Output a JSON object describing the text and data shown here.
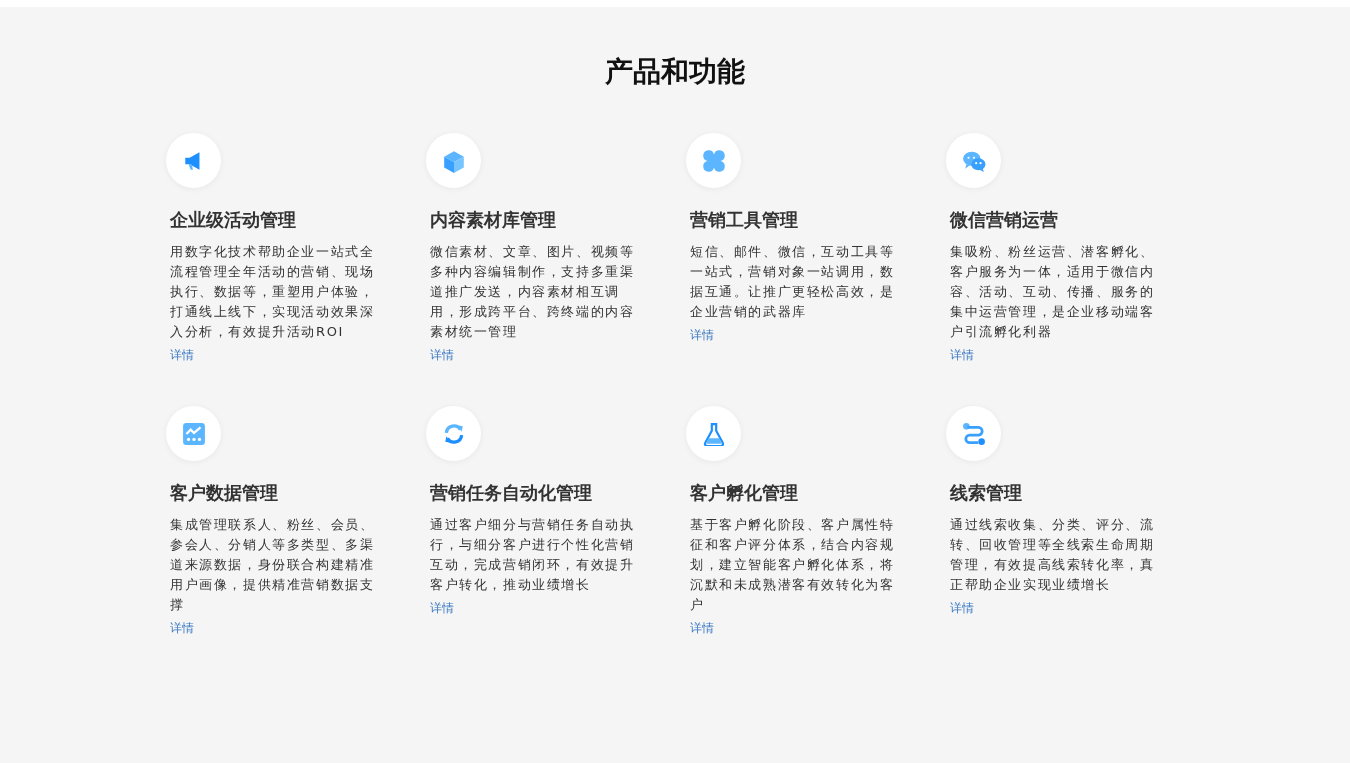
{
  "section": {
    "title": "产品和功能"
  },
  "features": [
    {
      "title": "企业级活动管理",
      "description": "用数字化技术帮助企业一站式全流程管理全年活动的营销、现场执行、数据等，重塑用户体验，打通线上线下，实现活动效果深入分析，有效提升活动ROI",
      "link": "详情"
    },
    {
      "title": "内容素材库管理",
      "description": "微信素材、文章、图片、视频等多种内容编辑制作，支持多重渠道推广发送，内容素材相互调用，形成跨平台、跨终端的内容素材统一管理",
      "link": "详情"
    },
    {
      "title": "营销工具管理",
      "description": "短信、邮件、微信，互动工具等一站式，营销对象一站调用，数据互通。让推广更轻松高效，是企业营销的武器库",
      "link": "详情"
    },
    {
      "title": "微信营销运营",
      "description": "集吸粉、粉丝运营、潜客孵化、客户服务为一体，适用于微信内容、活动、互动、传播、服务的集中运营管理，是企业移动端客户引流孵化利器",
      "link": "详情"
    },
    {
      "title": "客户数据管理",
      "description": "集成管理联系人、粉丝、会员、参会人、分销人等多类型、多渠道来源数据，身份联合构建精准用户画像，提供精准营销数据支撑",
      "link": "详情"
    },
    {
      "title": "营销任务自动化管理",
      "description": "通过客户细分与营销任务自动执行，与细分客户进行个性化营销互动，完成营销闭环，有效提升客户转化，推动业绩增长",
      "link": "详情"
    },
    {
      "title": "客户孵化管理",
      "description": "基于客户孵化阶段、客户属性特征和客户评分体系，结合内容规划，建立智能客户孵化体系，将沉默和未成熟潜客有效转化为客户",
      "link": "详情"
    },
    {
      "title": "线索管理",
      "description": "通过线索收集、分类、评分、流转、回收管理等全线索生命周期管理，有效提高线索转化率，真正帮助企业实现业绩增长",
      "link": "详情"
    }
  ]
}
